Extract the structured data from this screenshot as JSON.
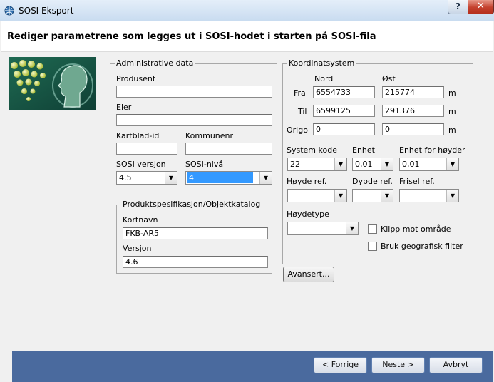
{
  "window": {
    "title": "SOSI Eksport",
    "help_label": "?",
    "close_label": "✕"
  },
  "heading": "Rediger parametrene som legges ut i SOSI-hodet i starten på SOSI-fila",
  "admin": {
    "legend": "Administrative data",
    "produsent_label": "Produsent",
    "produsent_value": "",
    "eier_label": "Eier",
    "eier_value": "",
    "kartblad_label": "Kartblad-id",
    "kartblad_value": "",
    "kommunenr_label": "Kommunenr",
    "kommunenr_value": "",
    "sosi_versjon_label": "SOSI versjon",
    "sosi_versjon_value": "4.5",
    "sosi_niva_label": "SOSI-nivå",
    "sosi_niva_value": "4",
    "produkt": {
      "legend": "Produktspesifikasjon/Objektkatalog",
      "kortnavn_label": "Kortnavn",
      "kortnavn_value": "FKB-AR5",
      "versjon_label": "Versjon",
      "versjon_value": "4.6"
    }
  },
  "koord": {
    "legend": "Koordinatsystem",
    "nord_label": "Nord",
    "ost_label": "Øst",
    "fra_label": "Fra",
    "til_label": "Til",
    "origo_label": "Origo",
    "fra_nord": "6554733",
    "fra_ost": "215774",
    "til_nord": "6599125",
    "til_ost": "291376",
    "origo_nord": "0",
    "origo_ost": "0",
    "unit": "m",
    "system_kode_label": "System kode",
    "system_kode_value": "22",
    "enhet_label": "Enhet",
    "enhet_value": "0,01",
    "enhet_hoyder_label": "Enhet for høyder",
    "enhet_hoyder_value": "0,01",
    "hoyde_ref_label": "Høyde ref.",
    "hoyde_ref_value": "",
    "dybde_ref_label": "Dybde ref.",
    "dybde_ref_value": "",
    "frisel_ref_label": "Frisel ref.",
    "frisel_ref_value": "",
    "hoydetype_label": "Høydetype",
    "hoydetype_value": "",
    "klipp_label": "Klipp mot område",
    "klipp_checked": false,
    "geo_filter_label": "Bruk geografisk filter",
    "geo_filter_checked": false
  },
  "avansert_label": "Avansert...",
  "footer": {
    "forrige_pre": "< ",
    "forrige_key": "F",
    "forrige_rest": "orrige",
    "neste_key": "N",
    "neste_rest": "este >",
    "avbryt_label": "Avbryt"
  },
  "colors": {
    "footer_bg": "#4a6a9e",
    "selection": "#3399ff"
  }
}
